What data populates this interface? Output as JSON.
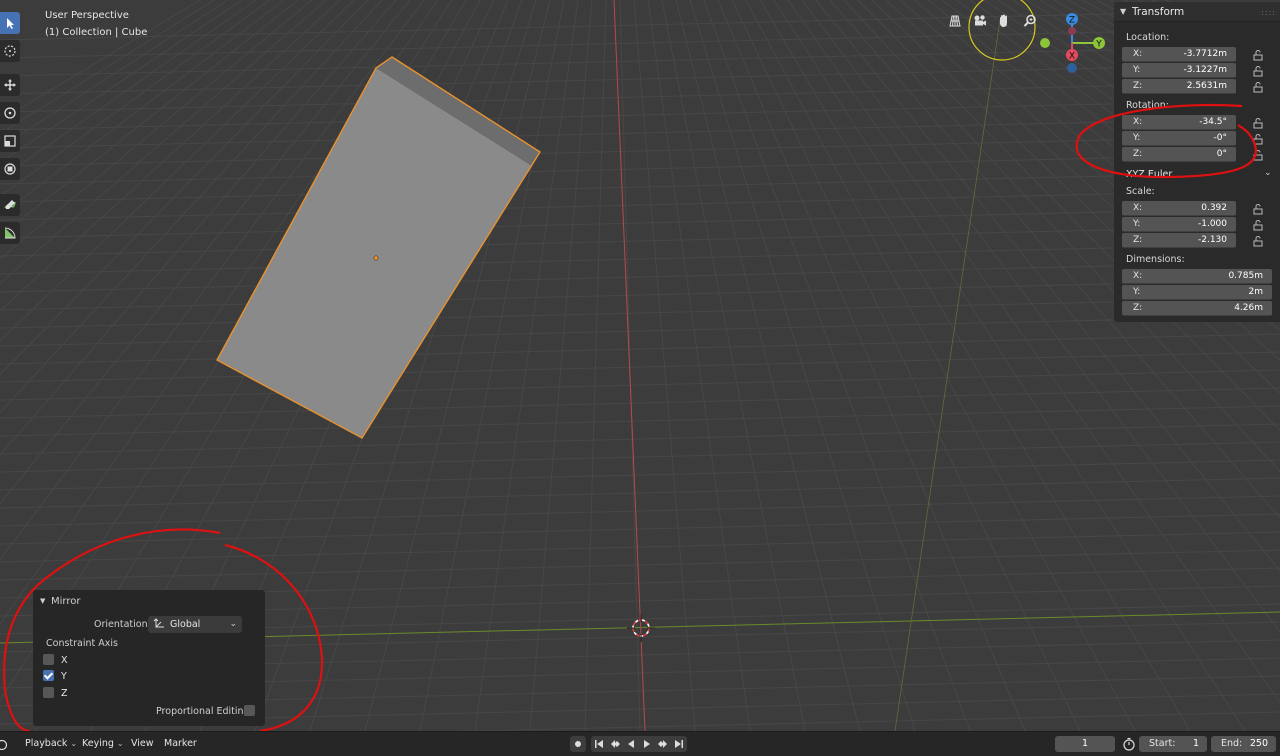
{
  "viewport": {
    "perspective_label": "User Perspective",
    "collection_label": "(1) Collection | Cube"
  },
  "toolbar": {
    "tools": [
      "select-box",
      "cursor",
      "move",
      "rotate",
      "scale",
      "transform",
      "annotate",
      "measure"
    ],
    "active_tool": "select-box"
  },
  "navigation": {
    "gizmo_axes": [
      "Z",
      "Y",
      "X"
    ],
    "buttons": [
      "grid-toggle",
      "camera",
      "pan",
      "zoom"
    ]
  },
  "transform": {
    "title": "Transform",
    "location": {
      "label": "Location:",
      "x": {
        "axis": "X:",
        "value": "-3.7712m"
      },
      "y": {
        "axis": "Y:",
        "value": "-3.1227m"
      },
      "z": {
        "axis": "Z:",
        "value": "2.5631m"
      }
    },
    "rotation": {
      "label": "Rotation:",
      "x": {
        "axis": "X:",
        "value": "-34.5°"
      },
      "y": {
        "axis": "Y:",
        "value": "-0°"
      },
      "z": {
        "axis": "Z:",
        "value": "0°"
      },
      "mode": "XYZ Euler"
    },
    "scale": {
      "label": "Scale:",
      "x": {
        "axis": "X:",
        "value": "0.392"
      },
      "y": {
        "axis": "Y:",
        "value": "-1.000"
      },
      "z": {
        "axis": "Z:",
        "value": "-2.130"
      }
    },
    "dimensions": {
      "label": "Dimensions:",
      "x": {
        "axis": "X:",
        "value": "0.785m"
      },
      "y": {
        "axis": "Y:",
        "value": "2m"
      },
      "z": {
        "axis": "Z:",
        "value": "4.26m"
      }
    }
  },
  "mirror": {
    "title": "Mirror",
    "orientation_label": "Orientation",
    "orientation_value": "Global",
    "constraint_label": "Constraint Axis",
    "axes": [
      {
        "label": "X",
        "checked": false
      },
      {
        "label": "Y",
        "checked": true
      },
      {
        "label": "Z",
        "checked": false
      }
    ],
    "proportional_label": "Proportional Editing"
  },
  "timeline": {
    "menus": [
      "Playback",
      "Keying",
      "View",
      "Marker"
    ],
    "current_frame": "1",
    "start_label": "Start:",
    "start_value": "1",
    "end_label": "End:",
    "end_value": "250"
  },
  "colors": {
    "accent": "#4772b3",
    "selection_outline": "#e8922e",
    "x_axis": "#e44a5d",
    "y_axis": "#8cc43a",
    "z_axis": "#3a8be0",
    "annotation": "#e01010"
  }
}
